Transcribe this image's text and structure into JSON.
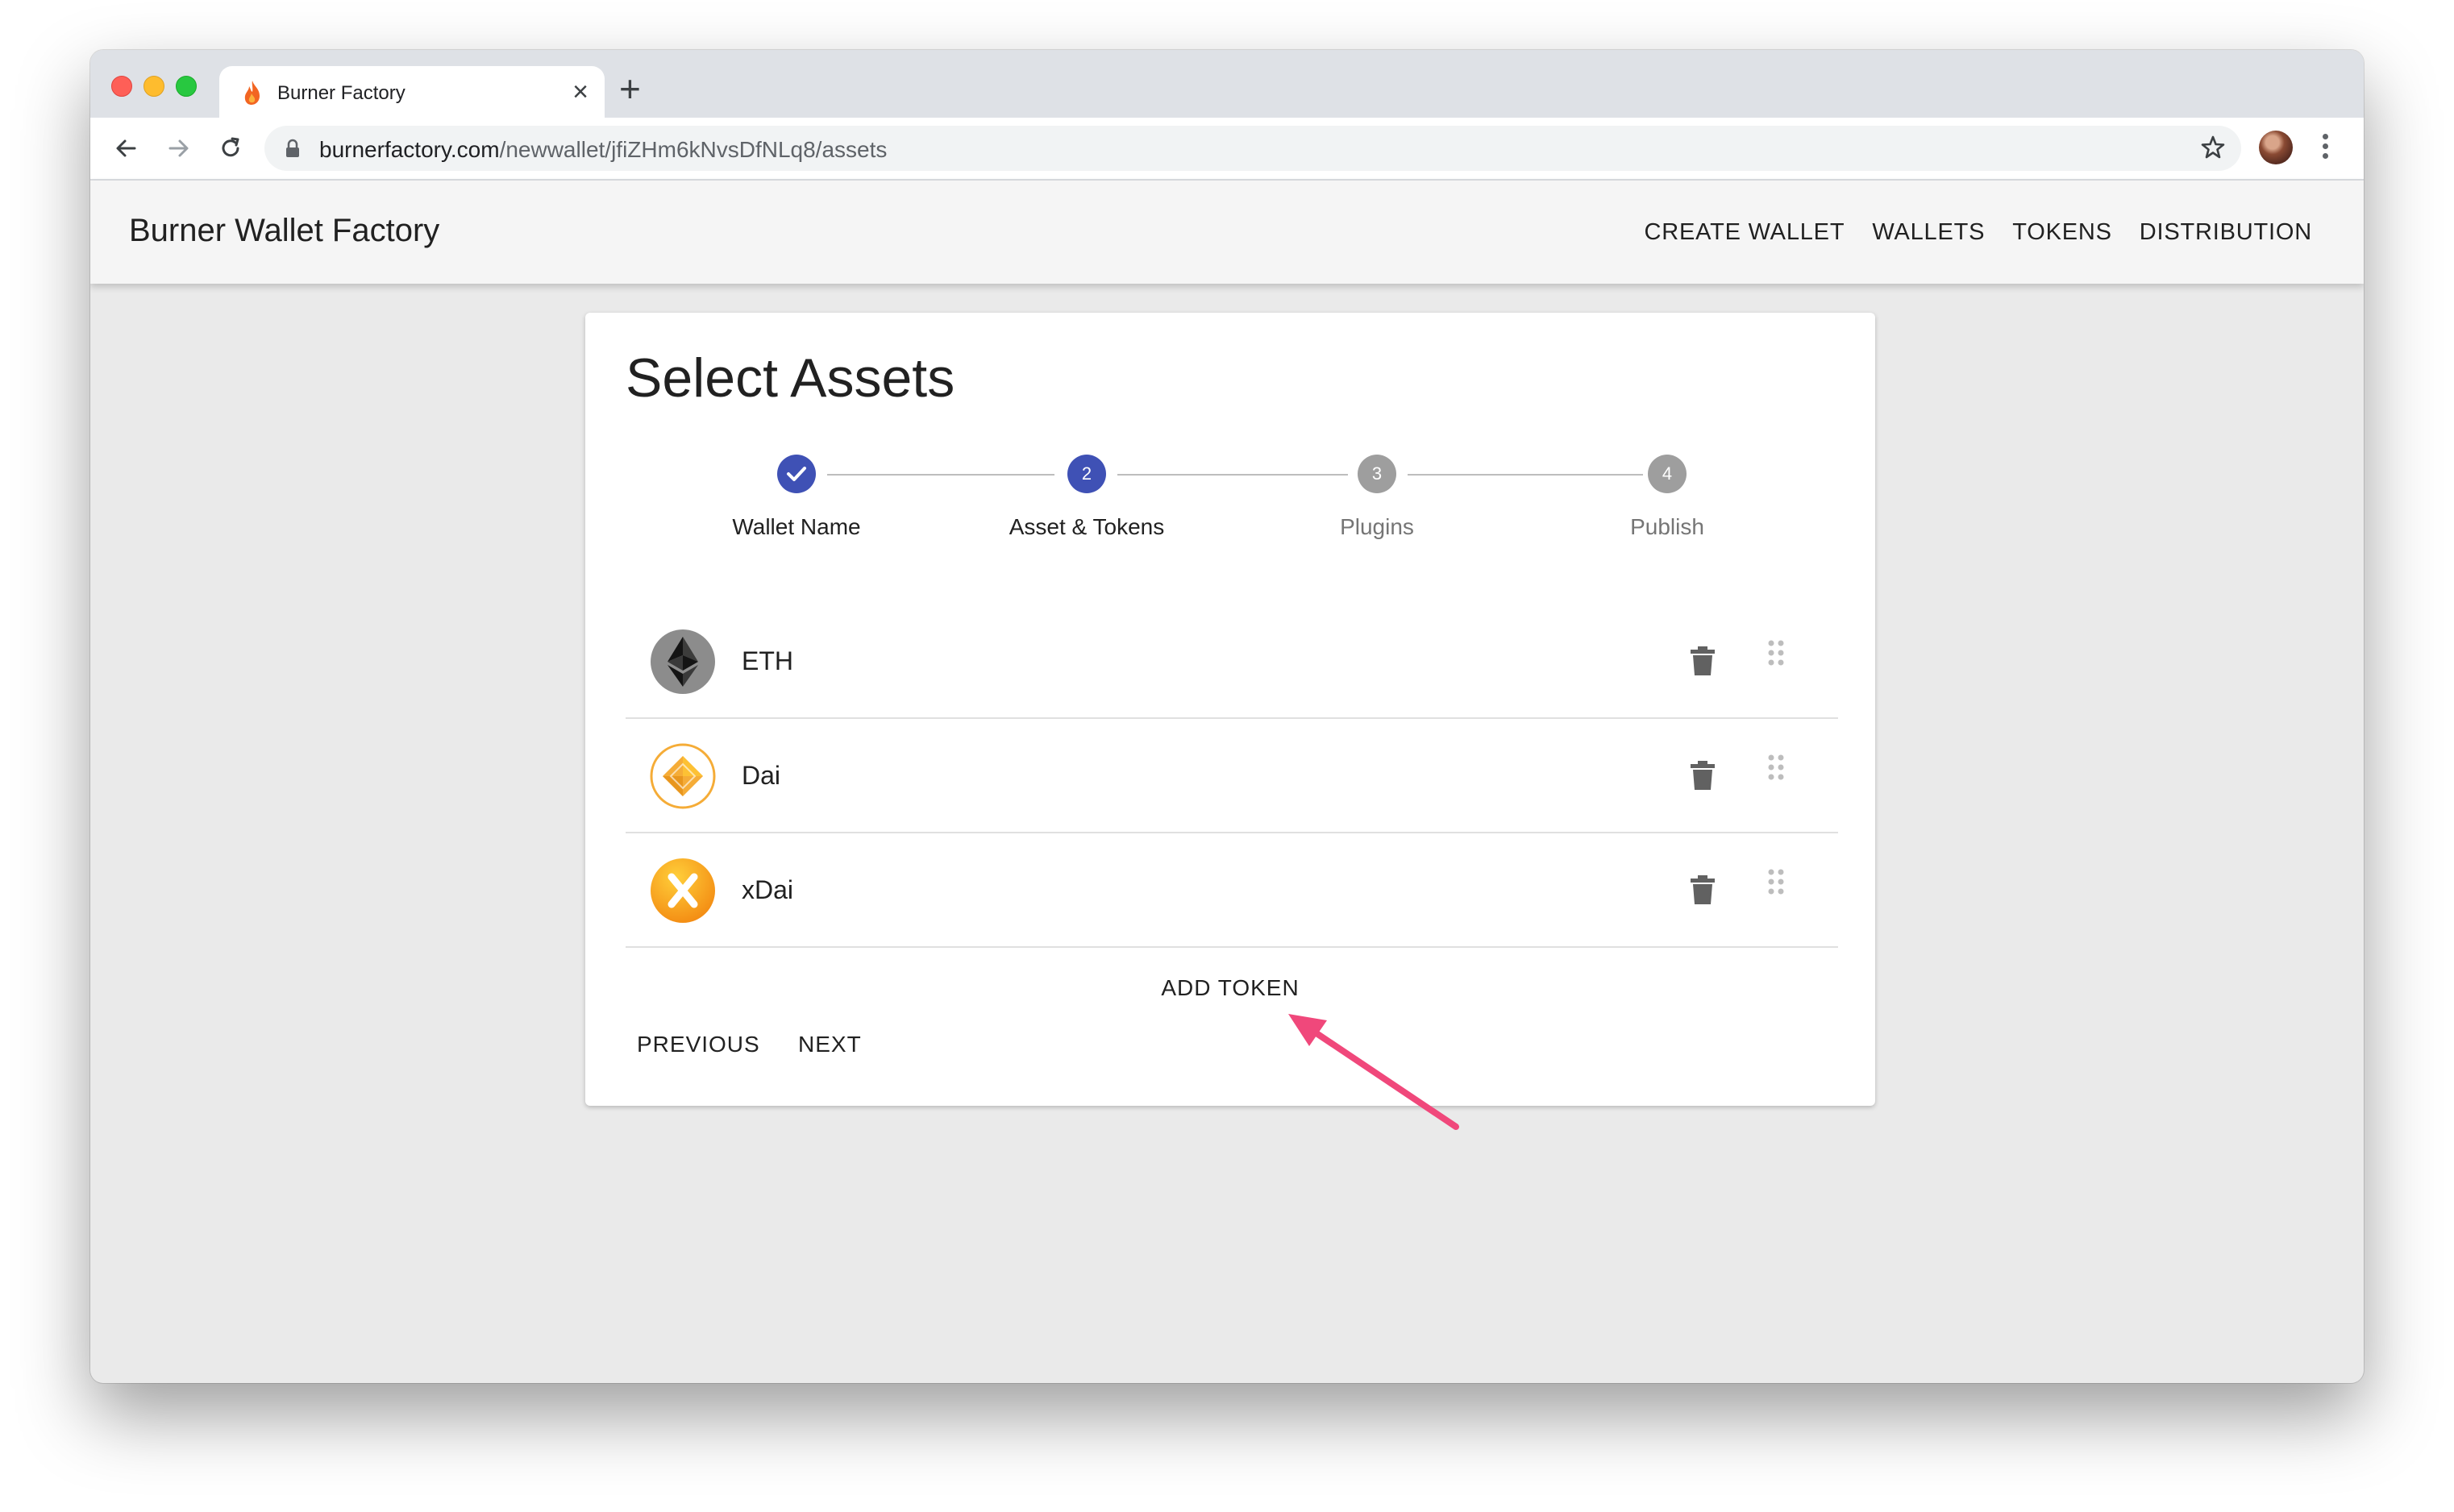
{
  "browser": {
    "tab_title": "Burner Factory",
    "tab_close": "×",
    "new_tab": "+",
    "url_domain": "burnerfactory.com",
    "url_path": "/newwallet/jfiZHm6kNvsDfNLq8/assets"
  },
  "app": {
    "title": "Burner Wallet Factory",
    "nav": [
      "CREATE WALLET",
      "WALLETS",
      "TOKENS",
      "DISTRIBUTION"
    ]
  },
  "card": {
    "title": "Select Assets",
    "steps": [
      {
        "label": "Wallet Name",
        "number": "",
        "status": "completed"
      },
      {
        "label": "Asset & Tokens",
        "number": "2",
        "status": "active"
      },
      {
        "label": "Plugins",
        "number": "3",
        "status": "inactive"
      },
      {
        "label": "Publish",
        "number": "4",
        "status": "inactive"
      }
    ],
    "assets": [
      {
        "name": "ETH",
        "icon": "eth-icon"
      },
      {
        "name": "Dai",
        "icon": "dai-icon"
      },
      {
        "name": "xDai",
        "icon": "xdai-icon"
      }
    ],
    "add_token": "ADD TOKEN",
    "previous": "PREVIOUS",
    "next": "NEXT"
  },
  "colors": {
    "primary": "#3f51b5",
    "inactive_step": "#9e9e9e",
    "annotation_arrow": "#f0487b",
    "dai": "#f5ac37",
    "xdai": "#f7a21b"
  }
}
